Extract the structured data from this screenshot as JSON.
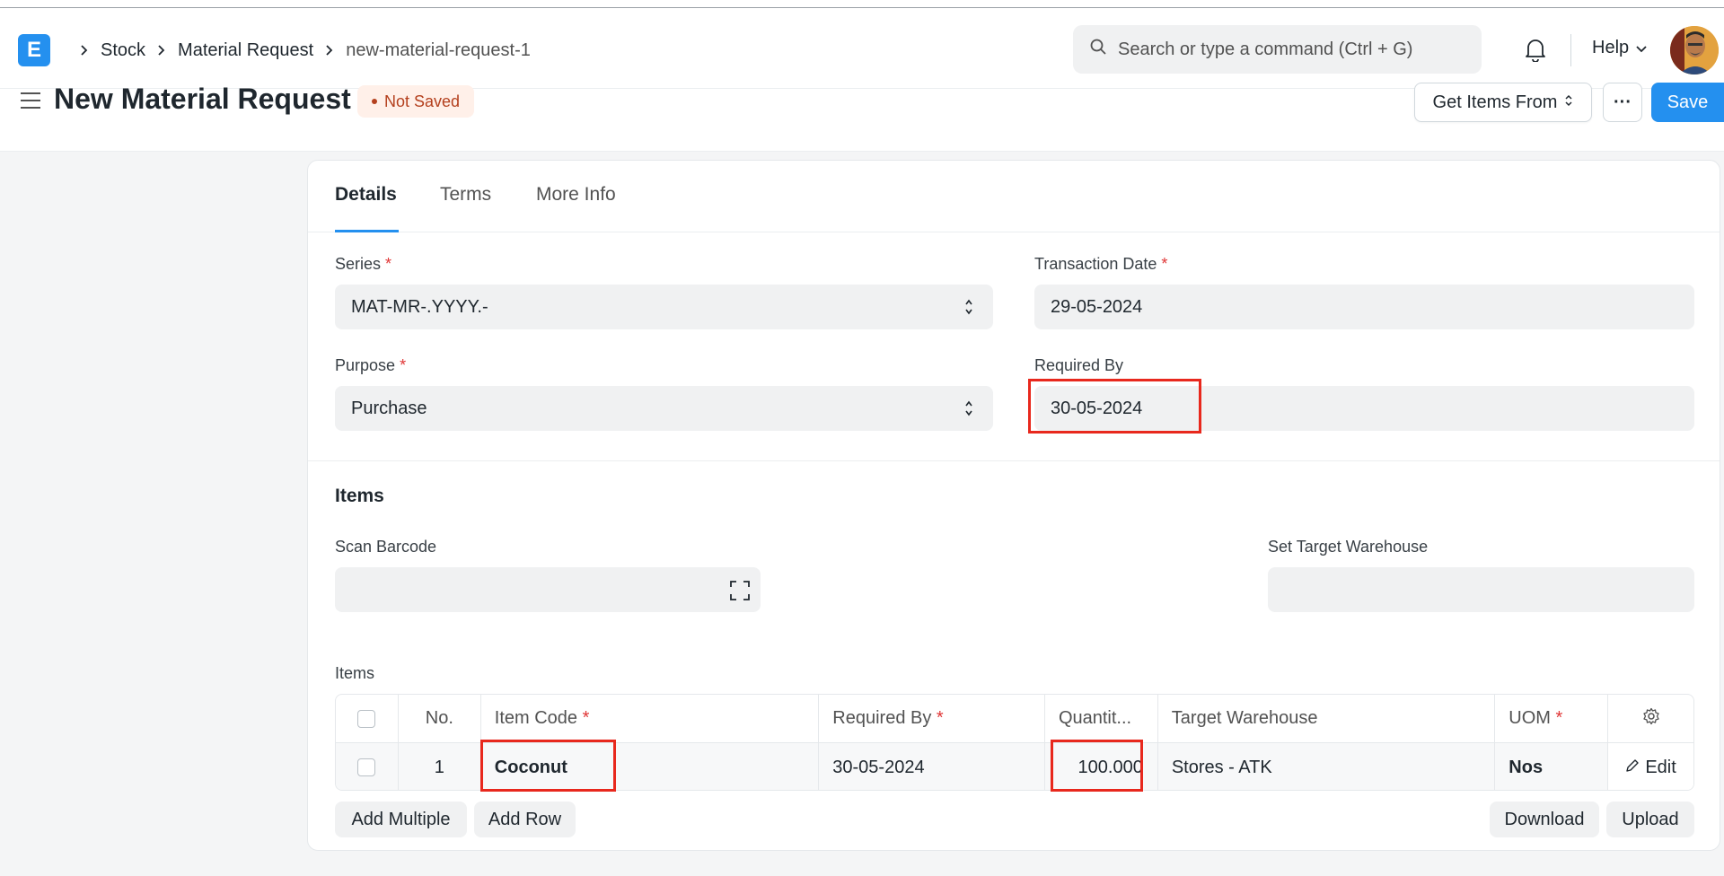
{
  "navbar": {
    "logo_letter": "E",
    "breadcrumbs": [
      "Stock",
      "Material Request",
      "new-material-request-1"
    ],
    "search_placeholder": "Search or type a command (Ctrl + G)",
    "help_label": "Help"
  },
  "page": {
    "title": "New Material Request",
    "status": "Not Saved",
    "get_items_label": "Get Items From",
    "more_label": "···",
    "save_label": "Save"
  },
  "tabs": [
    "Details",
    "Terms",
    "More Info"
  ],
  "form": {
    "series_label": "Series",
    "series_value": "MAT-MR-.YYYY.-",
    "transaction_date_label": "Transaction Date",
    "transaction_date_value": "29-05-2024",
    "purpose_label": "Purpose",
    "purpose_value": "Purchase",
    "required_by_label": "Required By",
    "required_by_value": "30-05-2024",
    "required_mark": "*"
  },
  "items_section": {
    "title": "Items",
    "scan_barcode_label": "Scan Barcode",
    "set_target_warehouse_label": "Set Target Warehouse",
    "table_label": "Items",
    "columns": [
      "No.",
      "Item Code",
      "Required By",
      "Quantit...",
      "Target Warehouse",
      "UOM"
    ],
    "row": {
      "no": "1",
      "item_code": "Coconut",
      "required_by": "30-05-2024",
      "quantity": "100.000",
      "target_warehouse": "Stores - ATK",
      "uom": "Nos",
      "edit_label": "Edit"
    },
    "add_multiple_label": "Add Multiple",
    "add_row_label": "Add Row",
    "download_label": "Download",
    "upload_label": "Upload"
  },
  "colors": {
    "primary": "#2490ef",
    "status_bg": "#fff0e9",
    "status_text": "#b4401e",
    "highlight": "#e8281d"
  }
}
